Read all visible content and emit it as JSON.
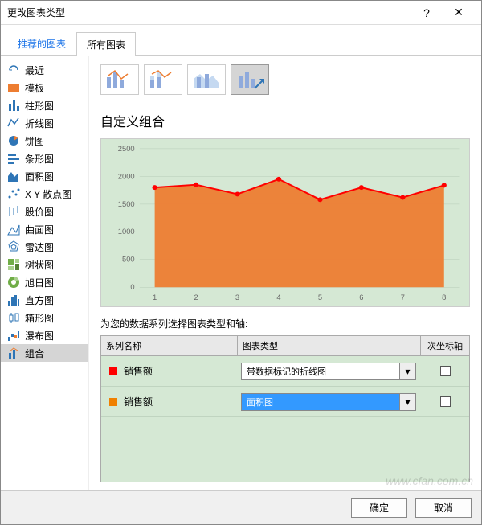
{
  "title": "更改图表类型",
  "tabs": {
    "recommended": "推荐的图表",
    "all": "所有图表"
  },
  "sidebar": {
    "items": [
      {
        "label": "最近"
      },
      {
        "label": "模板"
      },
      {
        "label": "柱形图"
      },
      {
        "label": "折线图"
      },
      {
        "label": "饼图"
      },
      {
        "label": "条形图"
      },
      {
        "label": "面积图"
      },
      {
        "label": "X Y 散点图"
      },
      {
        "label": "股价图"
      },
      {
        "label": "曲面图"
      },
      {
        "label": "雷达图"
      },
      {
        "label": "树状图"
      },
      {
        "label": "旭日图"
      },
      {
        "label": "直方图"
      },
      {
        "label": "箱形图"
      },
      {
        "label": "瀑布图"
      },
      {
        "label": "组合"
      }
    ]
  },
  "section_title": "自定义组合",
  "instruction": "为您的数据系列选择图表类型和轴:",
  "headers": {
    "name": "系列名称",
    "type": "图表类型",
    "axis": "次坐标轴"
  },
  "series": [
    {
      "name": "销售额",
      "color": "#ff0000",
      "type": "带数据标记的折线图",
      "highlight": false
    },
    {
      "name": "销售额",
      "color": "#f08000",
      "type": "面积图",
      "highlight": true
    }
  ],
  "buttons": {
    "ok": "确定",
    "cancel": "取消"
  },
  "watermark": "www.cfan.com.cn",
  "chart_data": {
    "type": "combo",
    "x": [
      1,
      2,
      3,
      4,
      5,
      6,
      7,
      8
    ],
    "ylim": [
      0,
      2500
    ],
    "yticks": [
      0,
      500,
      1000,
      1500,
      2000,
      2500
    ],
    "series": [
      {
        "name": "销售额",
        "kind": "area",
        "color": "#ed7d31",
        "values": [
          1800,
          1850,
          1680,
          1950,
          1580,
          1800,
          1620,
          1840
        ]
      },
      {
        "name": "销售额",
        "kind": "line-marker",
        "color": "#ff0000",
        "values": [
          1800,
          1850,
          1680,
          1950,
          1580,
          1800,
          1620,
          1840
        ]
      }
    ]
  }
}
